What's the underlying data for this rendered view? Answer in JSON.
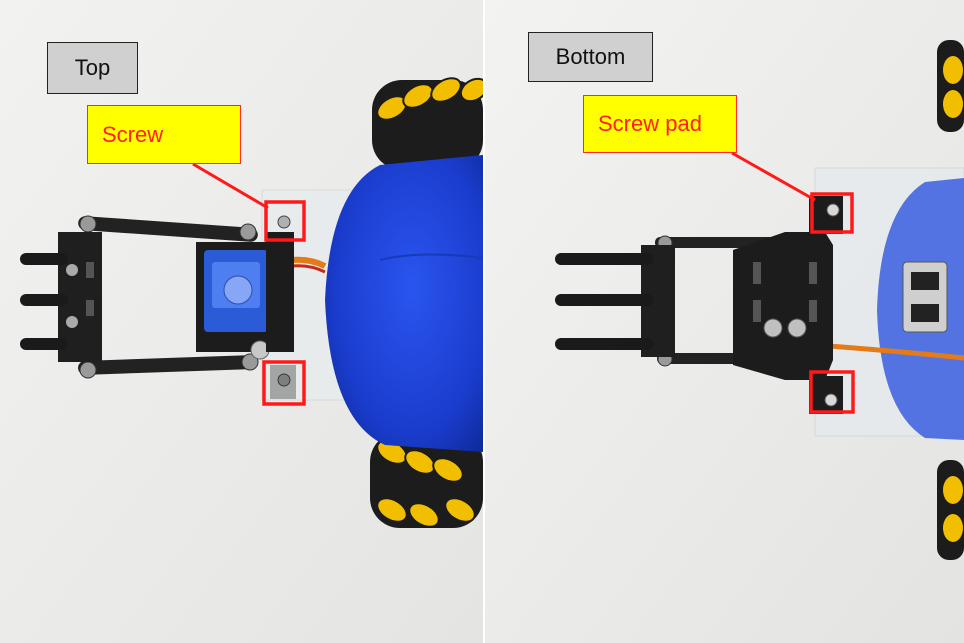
{
  "top_view": {
    "label": "Top",
    "callout": "Screw"
  },
  "bottom_view": {
    "label": "Bottom",
    "callout": "Screw pad"
  },
  "colors": {
    "callout_fill": "#ffff00",
    "callout_text": "#ff2020",
    "highlight_stroke": "#ff1a1a",
    "label_fill": "#d0d0d0",
    "robot_shell": "#1d3fd0",
    "wheel_roller": "#f5c400"
  }
}
